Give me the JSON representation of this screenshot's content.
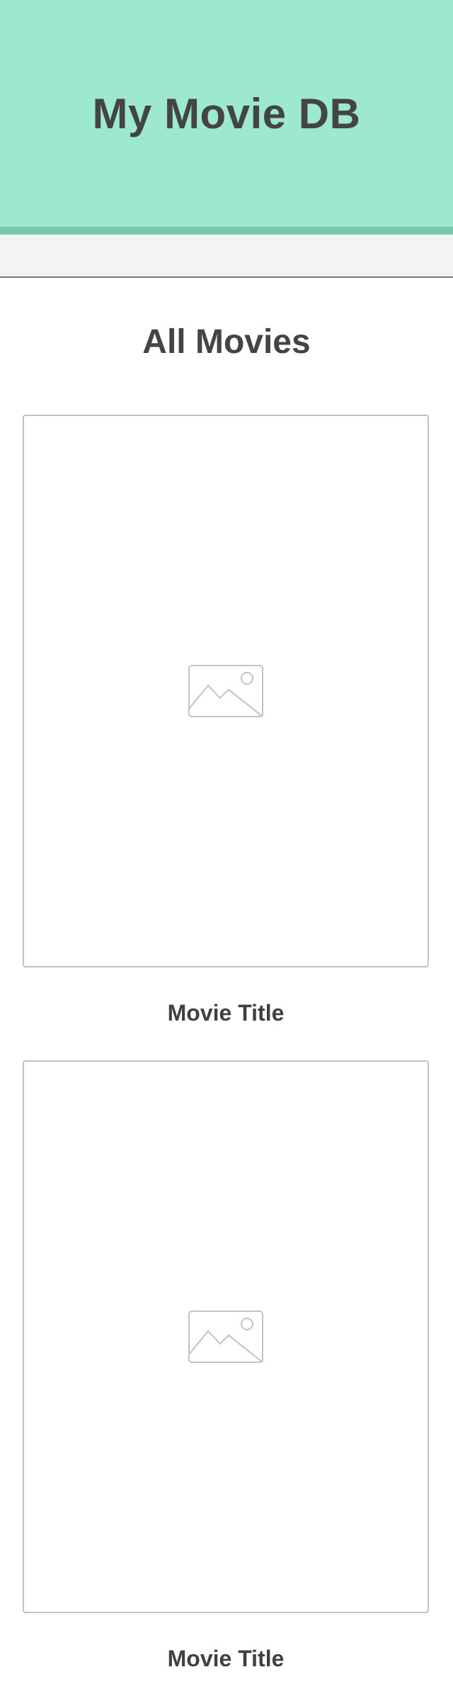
{
  "header": {
    "title": "My Movie DB"
  },
  "main": {
    "section_title": "All Movies",
    "movies": [
      {
        "title": "Movie Title",
        "poster_icon": "image-placeholder-icon"
      },
      {
        "title": "Movie Title",
        "poster_icon": "image-placeholder-icon"
      }
    ]
  },
  "colors": {
    "header_bg": "#9ce8d1",
    "header_border": "#7cc8ad",
    "nav_bg": "#f3f3f3",
    "text": "#444444",
    "placeholder_stroke": "#c2c2c2"
  }
}
